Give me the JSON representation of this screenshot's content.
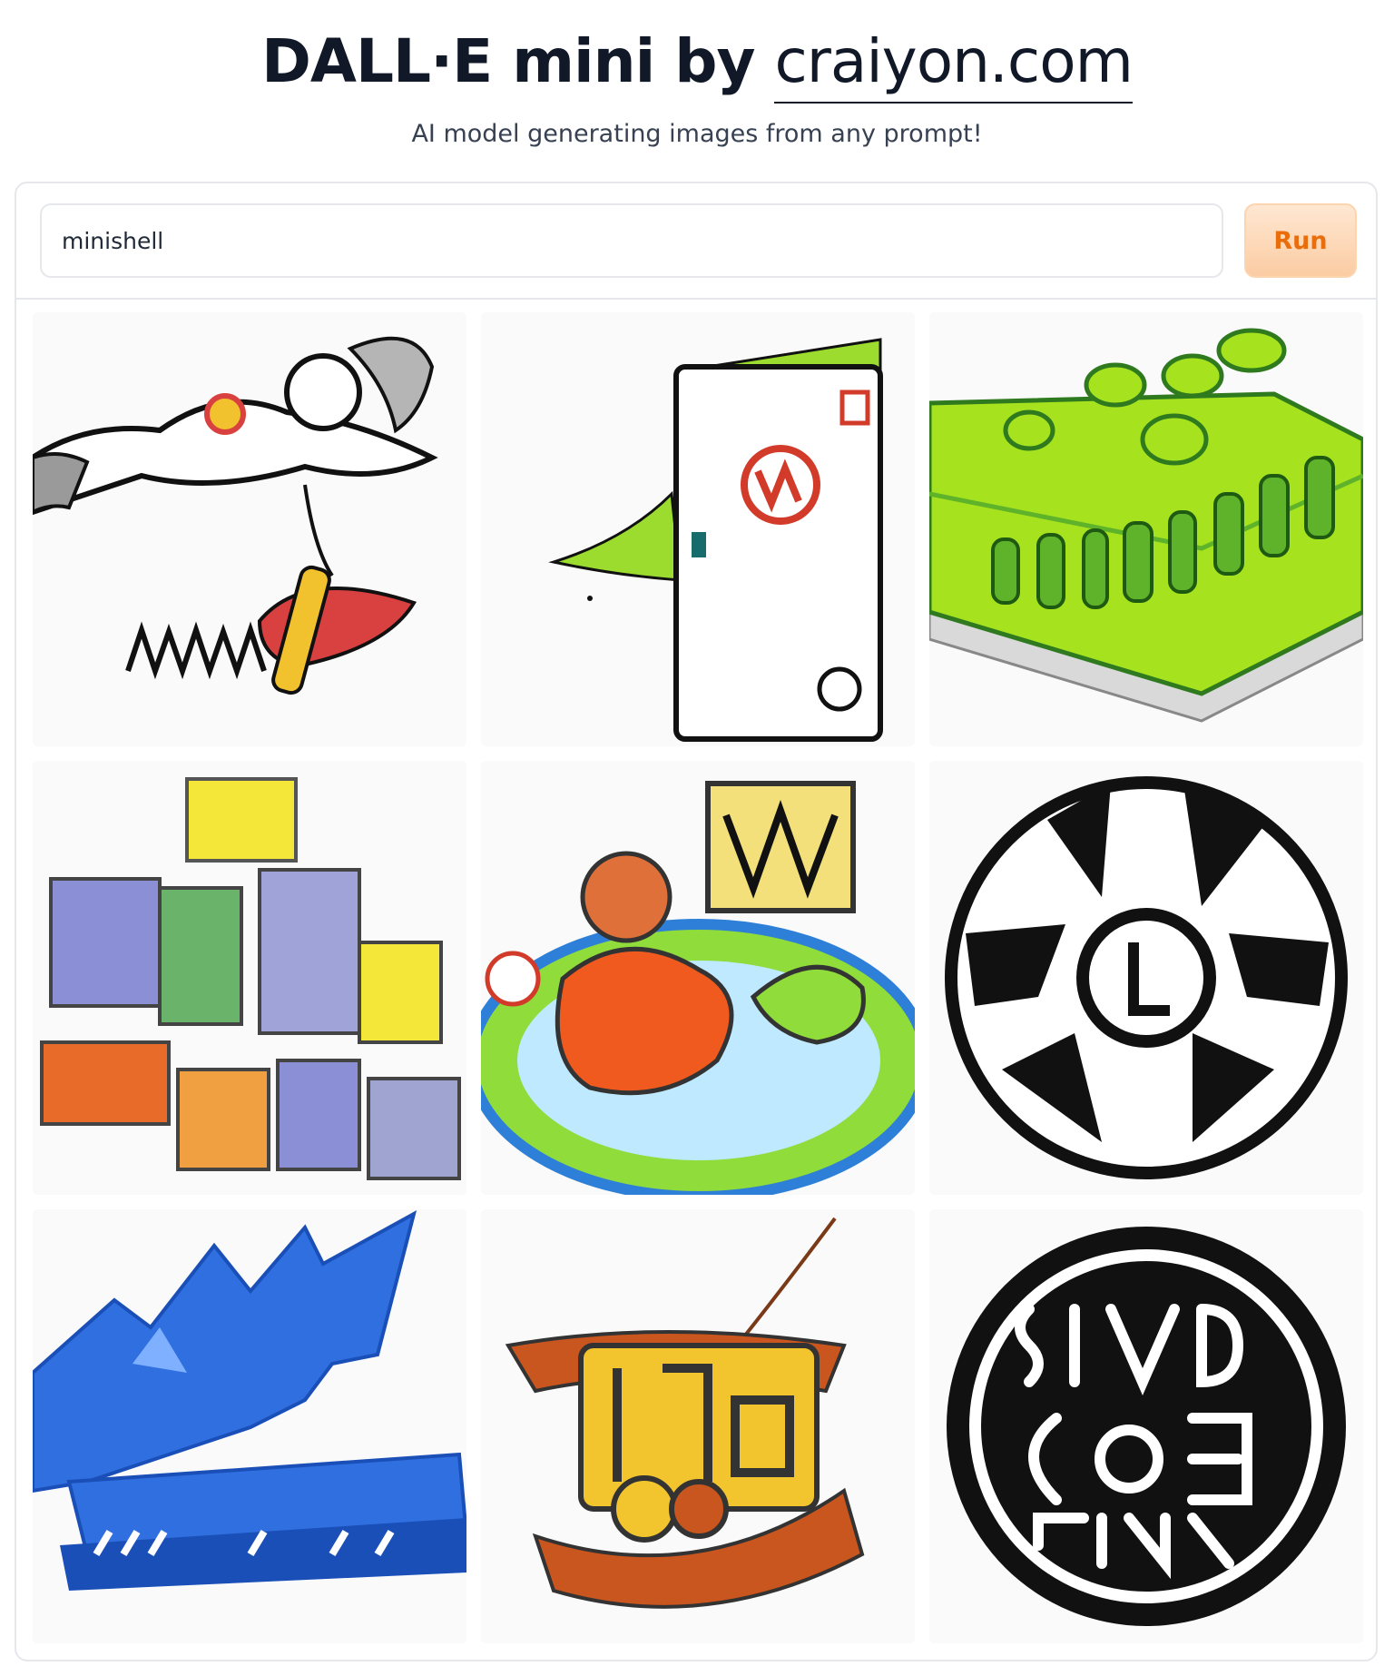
{
  "header": {
    "title_main": "DALL·E mini by",
    "title_link": "craiyon.com",
    "subtitle": "AI model generating images from any prompt!"
  },
  "form": {
    "prompt_value": "minishell",
    "run_label": "Run"
  },
  "results": {
    "images": [
      {
        "name": "generated-image-1",
        "palette": [
          "#d94040",
          "#f2c12e",
          "#9a9a9a",
          "#111111"
        ]
      },
      {
        "name": "generated-image-2",
        "palette": [
          "#9cdc2e",
          "#d23a2a",
          "#166b6b",
          "#111111"
        ]
      },
      {
        "name": "generated-image-3",
        "palette": [
          "#a6e31e",
          "#5fb32a",
          "#2f7a1e",
          "#d9d9d9"
        ]
      },
      {
        "name": "generated-image-4",
        "palette": [
          "#f5e63a",
          "#8a8fd6",
          "#6ab36a",
          "#e86b2a"
        ]
      },
      {
        "name": "generated-image-5",
        "palette": [
          "#f05a1e",
          "#2e7fd8",
          "#8fdc3a",
          "#f3e07a"
        ]
      },
      {
        "name": "generated-image-6",
        "palette": [
          "#111111",
          "#ffffff"
        ]
      },
      {
        "name": "generated-image-7",
        "palette": [
          "#2f6fe0",
          "#1a4fb8",
          "#7fb0ff",
          "#ffffff"
        ]
      },
      {
        "name": "generated-image-8",
        "palette": [
          "#c8561e",
          "#f2c52e",
          "#7a3a18",
          "#ffffff"
        ]
      },
      {
        "name": "generated-image-9",
        "palette": [
          "#111111",
          "#ffffff"
        ]
      }
    ]
  }
}
